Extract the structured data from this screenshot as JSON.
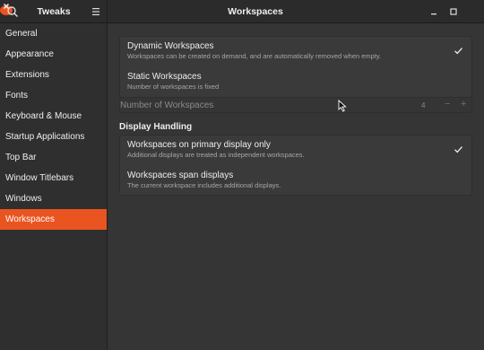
{
  "header": {
    "app_title": "Tweaks",
    "title": "Workspaces",
    "icons": {
      "search": "search-icon",
      "menu": "hamburger-menu-icon",
      "minimize": "minimize-icon",
      "maximize": "maximize-icon",
      "close": "close-icon"
    },
    "close_color": "#e95420"
  },
  "sidebar": {
    "items": [
      {
        "label": "General"
      },
      {
        "label": "Appearance"
      },
      {
        "label": "Extensions"
      },
      {
        "label": "Fonts"
      },
      {
        "label": "Keyboard & Mouse"
      },
      {
        "label": "Startup Applications"
      },
      {
        "label": "Top Bar"
      },
      {
        "label": "Window Titlebars"
      },
      {
        "label": "Windows"
      },
      {
        "label": "Workspaces"
      }
    ],
    "active": "Workspaces",
    "accent": "#e95420"
  },
  "main": {
    "workspace_mode": {
      "dynamic": {
        "title": "Dynamic Workspaces",
        "subtitle": "Workspaces can be created on demand, and are automatically removed when empty.",
        "selected": true
      },
      "static": {
        "title": "Static Workspaces",
        "subtitle": "Number of workspaces is fixed",
        "selected": false
      }
    },
    "number_of_workspaces": {
      "label": "Number of Workspaces",
      "value": "4",
      "minus": "−",
      "plus": "+"
    },
    "display_handling": {
      "heading": "Display Handling",
      "primary": {
        "title": "Workspaces on primary display only",
        "subtitle": "Additional displays are treated as independent workspaces.",
        "selected": true
      },
      "span": {
        "title": "Workspaces span displays",
        "subtitle": "The current workspace includes additional displays.",
        "selected": false
      }
    }
  }
}
